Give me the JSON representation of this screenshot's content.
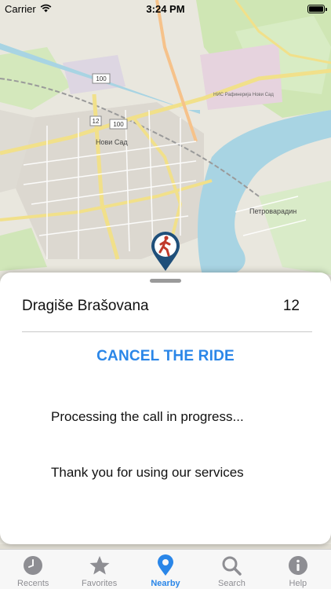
{
  "status_bar": {
    "carrier": "Carrier",
    "time": "3:24 PM"
  },
  "map": {
    "labels": {
      "novi_sad": "Нови Сад",
      "petrovaradin": "Петроварадин",
      "nis_refinery": "НИС Рафинерија Нови Сад",
      "road_100_a": "100",
      "road_100_b": "100",
      "road_12": "12"
    }
  },
  "sheet": {
    "street_name": "Dragiše Brašovana",
    "street_number": "12",
    "cancel_label": "CANCEL THE RIDE",
    "processing_text": "Processing the call in progress...",
    "thanks_text": "Thank you for using our services"
  },
  "tab_bar": {
    "items": [
      {
        "label": "Recents",
        "icon": "clock-icon",
        "active": false
      },
      {
        "label": "Favorites",
        "icon": "star-icon",
        "active": false
      },
      {
        "label": "Nearby",
        "icon": "location-pin-icon",
        "active": true
      },
      {
        "label": "Search",
        "icon": "search-icon",
        "active": false
      },
      {
        "label": "Help",
        "icon": "info-icon",
        "active": false
      }
    ]
  },
  "colors": {
    "accent": "#2a86e8",
    "inactive": "#8e8e93",
    "river": "#a8d4e3",
    "marker_ring": "#1f4f7a",
    "marker_figure": "#c0392b"
  }
}
